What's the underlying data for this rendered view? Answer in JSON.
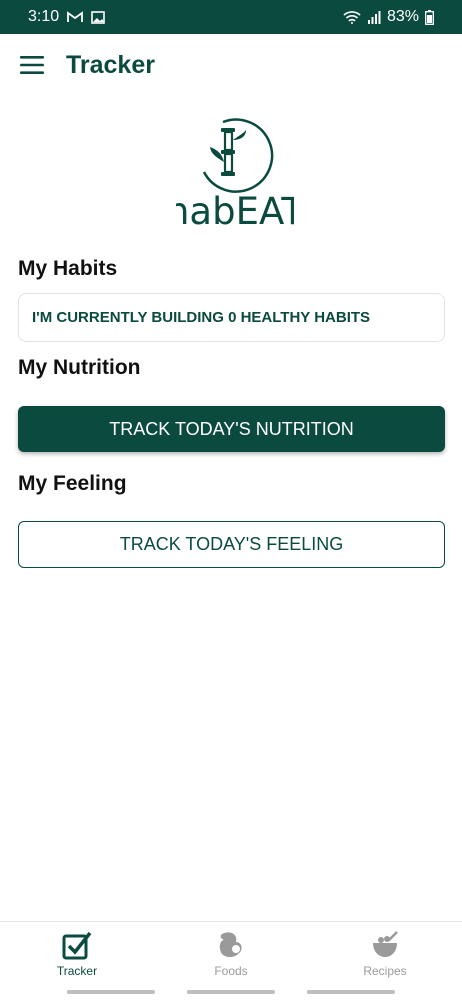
{
  "status_bar": {
    "time": "3:10",
    "battery_percent": "83%",
    "left_icons": [
      "gmail-icon",
      "image-icon"
    ],
    "right_icons": [
      "wifi-icon",
      "signal-icon",
      "battery-icon"
    ],
    "background_color": "#0b4b3f"
  },
  "app_bar": {
    "title": "Tracker",
    "menu_icon": "hamburger-menu-icon"
  },
  "logo": {
    "wordmark": "habEAT",
    "icon": "bamboo-leaf-icon"
  },
  "habits": {
    "heading": "My Habits",
    "card_text": "I'M CURRENTLY BUILDING 0 HEALTHY HABITS"
  },
  "nutrition": {
    "heading": "My Nutrition",
    "button_label": "TRACK TODAY'S NUTRITION"
  },
  "feeling": {
    "heading": "My Feeling",
    "button_label": "TRACK TODAY'S FEELING"
  },
  "bottom_nav": {
    "items": [
      {
        "label": "Tracker",
        "icon": "checkbox-icon",
        "active": true
      },
      {
        "label": "Foods",
        "icon": "food-icon",
        "active": false
      },
      {
        "label": "Recipes",
        "icon": "bowl-icon",
        "active": false
      }
    ]
  },
  "colors": {
    "primary": "#0b4b3f",
    "inactive": "#9a9a9a"
  }
}
